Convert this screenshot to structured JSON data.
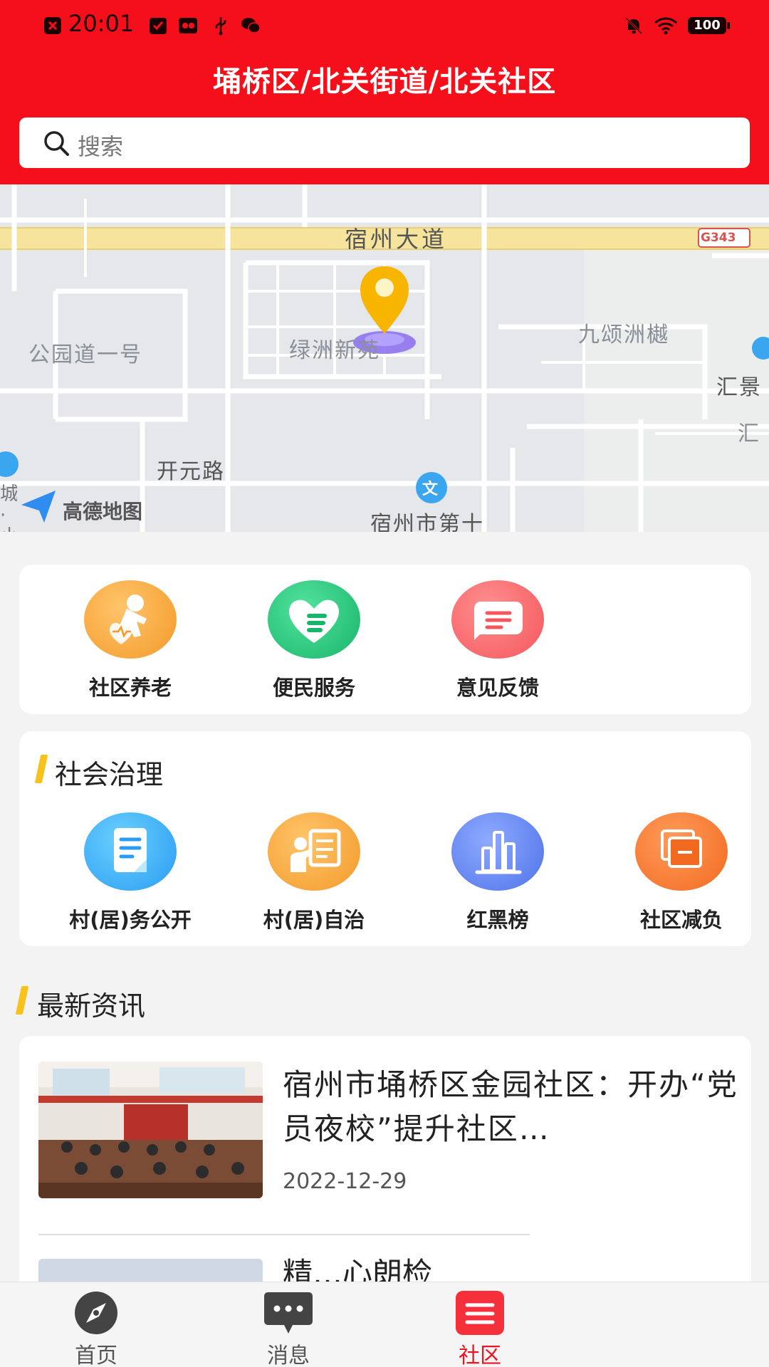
{
  "status_bar": {
    "time": "20:01",
    "battery": "100",
    "icons": [
      "notification-x-icon",
      "check-icon",
      "app-icon",
      "usb-icon",
      "wechat-icon",
      "mute-bell-icon",
      "wifi-icon",
      "battery-icon"
    ]
  },
  "header": {
    "location": "埇桥区/北关街道/北关社区",
    "search_placeholder": "搜索"
  },
  "map": {
    "labels": {
      "suzhou_avenue": "宿州大道",
      "g343": "G343",
      "jiusong": "九颂洲樾",
      "gongyuan": "公园道一号",
      "lvzhou": "绿洲新苑",
      "huijing": "汇景",
      "hui": "汇",
      "kaiyuan": "开元路",
      "suzhou_school": "宿州市第十",
      "amap": "高德地图",
      "wen_badge": "文",
      "edge_left": "城·小"
    }
  },
  "services": [
    {
      "label": "社区养老",
      "icon": "elderly-care-icon"
    },
    {
      "label": "便民服务",
      "icon": "heart-handshake-icon"
    },
    {
      "label": "意见反馈",
      "icon": "feedback-chat-icon"
    }
  ],
  "governance": {
    "title": "社会治理",
    "items": [
      {
        "label": "村(居)务公开",
        "icon": "document-icon"
      },
      {
        "label": "村(居)自治",
        "icon": "presentation-icon"
      },
      {
        "label": "红黑榜",
        "icon": "bar-chart-icon"
      },
      {
        "label": "社区减负",
        "icon": "layers-icon"
      }
    ]
  },
  "news": {
    "title": "最新资讯",
    "items": [
      {
        "title": "宿州市埇桥区金园社区：开办“党员夜校”提升社区…",
        "date": "2022-12-29"
      },
      {
        "title": "精…心朗检"
      }
    ]
  },
  "bottom_nav": [
    {
      "label": "首页",
      "icon": "compass-icon"
    },
    {
      "label": "消息",
      "icon": "message-icon"
    },
    {
      "label": "社区",
      "icon": "community-list-icon"
    }
  ],
  "colors": {
    "brand_red": "#f50f1a",
    "accent_yellow": "#f7c21a"
  }
}
